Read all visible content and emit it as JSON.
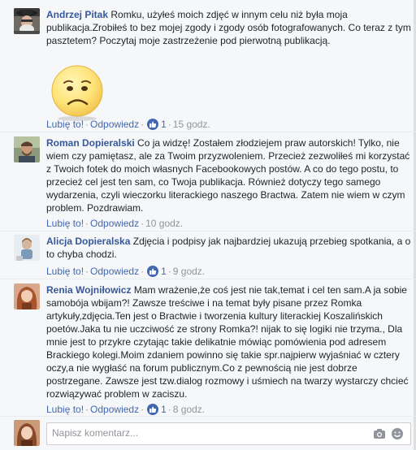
{
  "comments": [
    {
      "author": "Andrzej Pitak",
      "text": "Romku, użyłeś moich zdjęć w innym celu niż była moja publikacja.Zrobiłeś to bez mojej zgody i zgody osób fotografowanych. Co teraz z tym pasztetem? Poczytaj moje zastrzeżenie pod pierwotną publikacją.",
      "like_label": "Lubię to!",
      "reply_label": "Odpowiedz",
      "likes": "1",
      "time": "15 godz."
    },
    {
      "author": "Roman Dopieralski",
      "text": "Co ja widzę! Zostałem złodziejem praw autorskich! Tylko, nie wiem czy pamiętasz, ale za Twoim przyzwoleniem. Przecież zezwoliłeś mi korzystać z Twoich fotek do moich własnych Facebookowych postów. A co do tego postu, to przecież cel jest ten sam, co Twoja publikacja. Również dotyczy tego samego wydarzenia, czyli wieczorku literackiego naszego Bractwa. Zatem nie wiem w czym problem. Pozdrawiam.",
      "like_label": "Lubię to!",
      "reply_label": "Odpowiedz",
      "time": "10 godz."
    },
    {
      "author": "Alicja Dopieralska",
      "text": "Zdjęcia i podpisy jak najbardziej ukazują przebieg spotkania, a o to chyba chodzi.",
      "like_label": "Lubię to!",
      "reply_label": "Odpowiedz",
      "likes": "1",
      "time": "9 godz."
    },
    {
      "author": "Renia Wojniłowicz",
      "text": "Mam wrażenie,że coś jest nie tak,temat i cel ten sam.A ja sobie samobója wbijam?! Zawsze treściwe i na temat były pisane przez Romka artykuły,zdjęcia.Ten jest o Bractwie i tworzenia kultury literackiej Koszalińskich poetów.Jaka tu nie uczciwość ze strony Romka?! nijak to się logiki nie trzyma., Dla mnie jest to przykre czytając takie delikatnie mówiąc pomówienia pod adresem Brackiego kolegi.Moim zdaniem powinno się takie spr.najpierw wyjaśniać w cztery oczy,a nie wygłaść na forum publicznym.Co z pewnością nie jest dobrze postrzegane. Zawsze jest tzw.dialog rozmowy i uśmiech na twarzy wystarczy chcieć rozwiązywać problem w zaciszu.",
      "like_label": "Lubię to!",
      "reply_label": "Odpowiedz",
      "likes": "1",
      "time": "8 godz."
    }
  ],
  "composer": {
    "placeholder": "Napisz komentarz...",
    "icons": [
      "camera-icon",
      "emoji-icon"
    ]
  },
  "colors": {
    "link": "#365899",
    "action": "#4267b2",
    "meta": "#90949c",
    "background": "#f6f7f9"
  }
}
